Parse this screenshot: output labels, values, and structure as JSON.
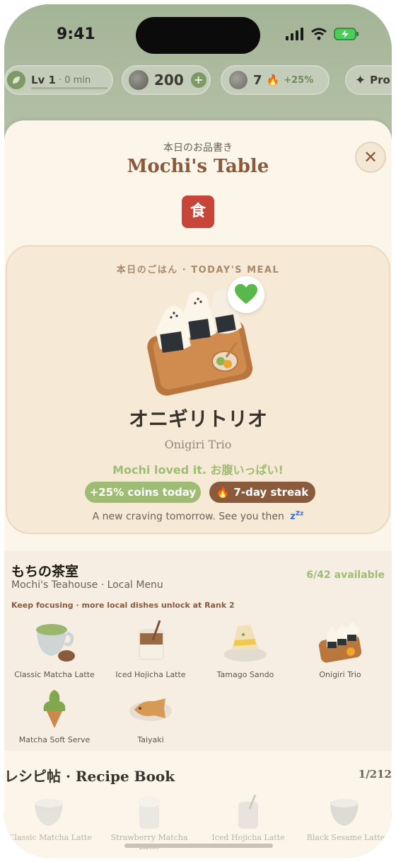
{
  "status_bar": {
    "time": "9:41"
  },
  "hud": {
    "level_label": "Lv 1",
    "level_time": "· 0 min",
    "coins": "200",
    "streak_count": "7",
    "streak_bonus": "+25%",
    "pro_label": "Pro"
  },
  "sheet": {
    "subtitle": "本日のお品書き",
    "title": "Mochi's Table",
    "kanji_badge": "食",
    "close_glyph": "✕"
  },
  "meal": {
    "label": "本日のごはん · TODAY'S MEAL",
    "name_jp": "オニギリトリオ",
    "name_en": "Onigiri Trio",
    "reaction": "Mochi loved it. お腹いっぱい!",
    "coin_chip": "+25% coins today",
    "streak_chip": "7-day streak",
    "footer": "A new craving tomorrow. See you then",
    "heart_icon": "green-heart"
  },
  "teahouse": {
    "title": "もちの茶室",
    "subtitle": "Mochi's Teahouse · Local Menu",
    "available": "6/42 available",
    "hint": "Keep focusing · more local dishes unlock at Rank 2",
    "dishes": [
      {
        "label": "Classic Matcha Latte"
      },
      {
        "label": "Iced Hojicha Latte"
      },
      {
        "label": "Tamago Sando"
      },
      {
        "label": "Onigiri Trio"
      },
      {
        "label": "Matcha Soft Serve"
      },
      {
        "label": "Taiyaki"
      }
    ]
  },
  "recipe_book": {
    "title": "レシピ帖 · Recipe Book",
    "count": "1/212",
    "items": [
      {
        "label": "Classic Matcha Latte"
      },
      {
        "label": "Strawberry Matcha Latte"
      },
      {
        "label": "Iced Hojicha Latte"
      },
      {
        "label": "Black Sesame Latte"
      }
    ]
  },
  "colors": {
    "accent_green": "#9fbc74",
    "brand_brown": "#8a5a3c",
    "badge_red": "#c8453a",
    "cream": "#fbf5ea"
  }
}
